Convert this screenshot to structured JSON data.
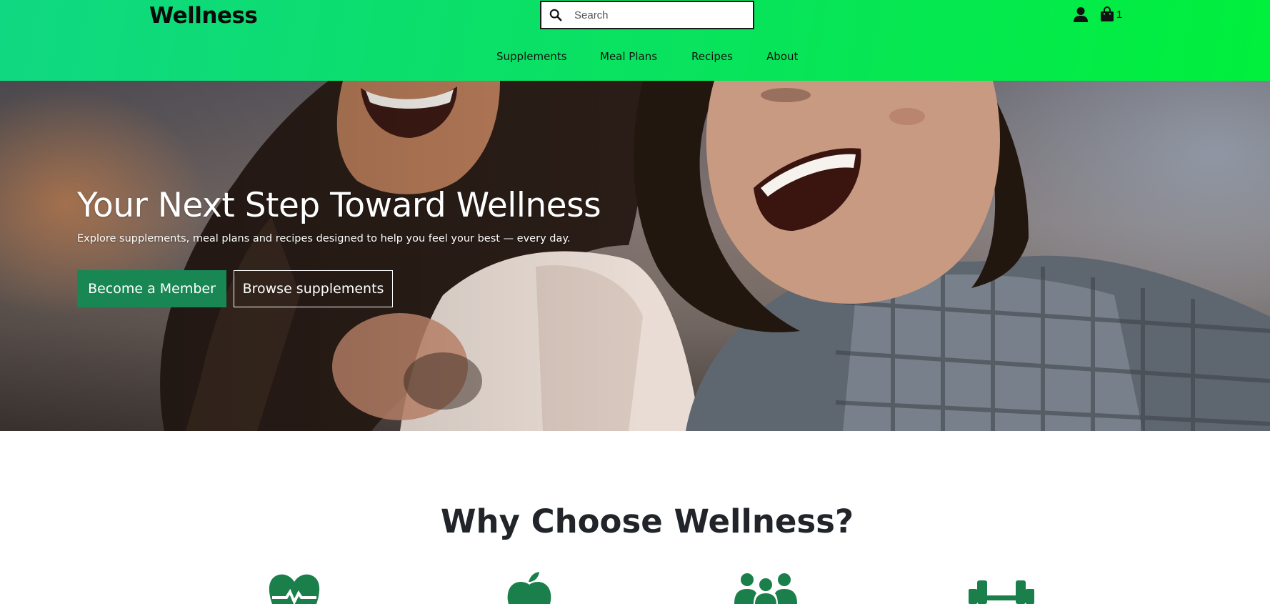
{
  "brand": {
    "name": "Wellness"
  },
  "search": {
    "placeholder": "Search"
  },
  "cart": {
    "count": "1"
  },
  "nav": {
    "items": [
      {
        "label": "Supplements"
      },
      {
        "label": "Meal Plans"
      },
      {
        "label": "Recipes"
      },
      {
        "label": "About"
      }
    ]
  },
  "hero": {
    "title": "Your Next Step Toward Wellness",
    "subtitle": "Explore supplements, meal plans and recipes designed to help you feel your best — every day.",
    "primary_button": "Become a Member",
    "secondary_button": "Browse supplements"
  },
  "why": {
    "title": "Why Choose Wellness?",
    "icons": [
      "heart-pulse-icon",
      "apple-icon",
      "people-group-icon",
      "dumbbell-icon"
    ]
  },
  "colors": {
    "header_gradient_start": "#10d882",
    "header_gradient_end": "#00f03c",
    "primary_green": "#198754",
    "icon_green": "#1a7f4b"
  }
}
